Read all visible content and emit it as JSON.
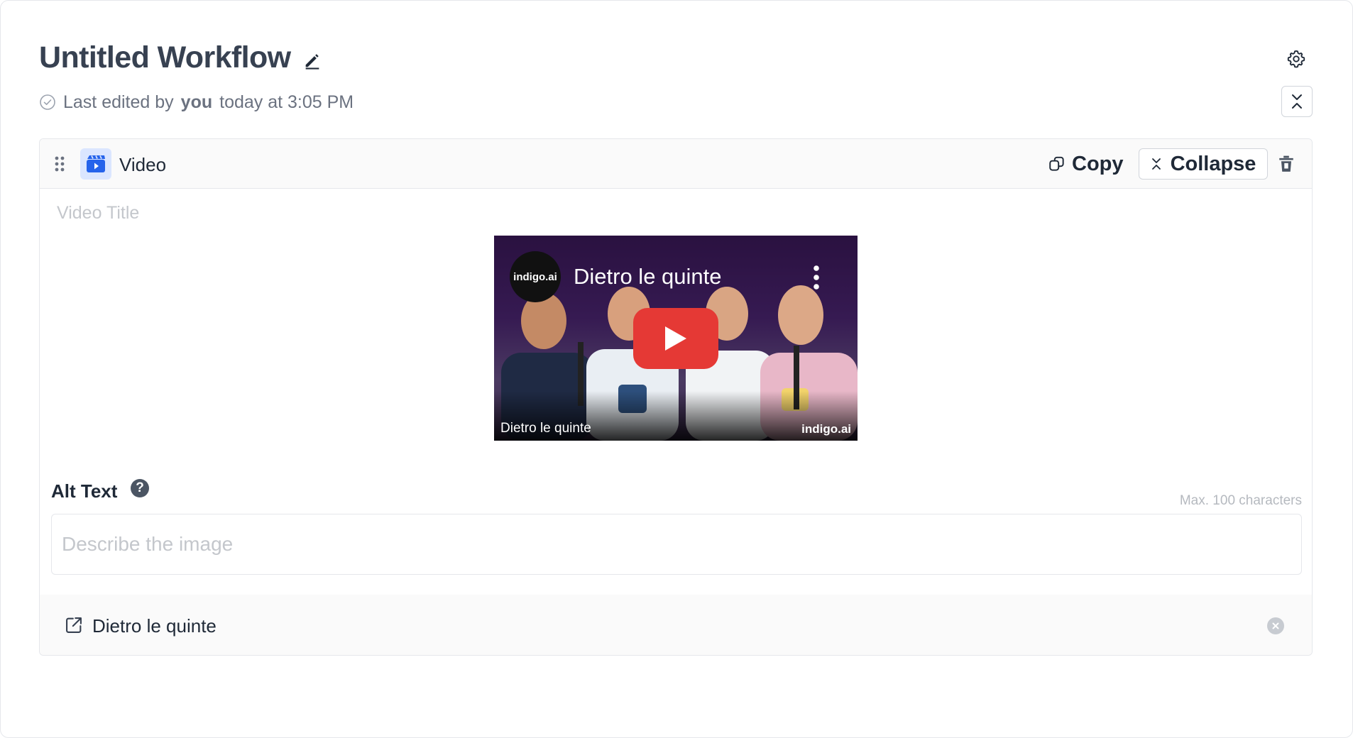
{
  "header": {
    "title": "Untitled Workflow",
    "status_prefix": "Last edited by",
    "status_user": "you",
    "status_suffix": "today at 3:05 PM"
  },
  "block": {
    "type_label": "Video",
    "copy_label": "Copy",
    "collapse_label": "Collapse",
    "video_title_placeholder": "Video Title",
    "thumbnail": {
      "channel_logo_text": "indigo.ai",
      "title": "Dietro le quinte",
      "caption_left": "Dietro le quinte",
      "caption_right": "indigo.ai"
    },
    "alt_text": {
      "label": "Alt Text",
      "help_glyph": "?",
      "max_chars": "Max. 100 characters",
      "placeholder": "Describe the image"
    },
    "link": {
      "text": "Dietro le quinte"
    }
  },
  "colors": {
    "accent": "#2563eb",
    "play_button": "#e53935",
    "block_icon_bg": "#dbe6ff"
  },
  "icons": [
    "pencil-icon",
    "gear-icon",
    "check-circle-icon",
    "collapse-vertical-icon",
    "drag-handle-icon",
    "video-icon",
    "copy-icon",
    "close-icon",
    "trash-icon",
    "more-vertical-icon",
    "play-icon",
    "help-icon",
    "external-link-icon",
    "remove-icon"
  ]
}
